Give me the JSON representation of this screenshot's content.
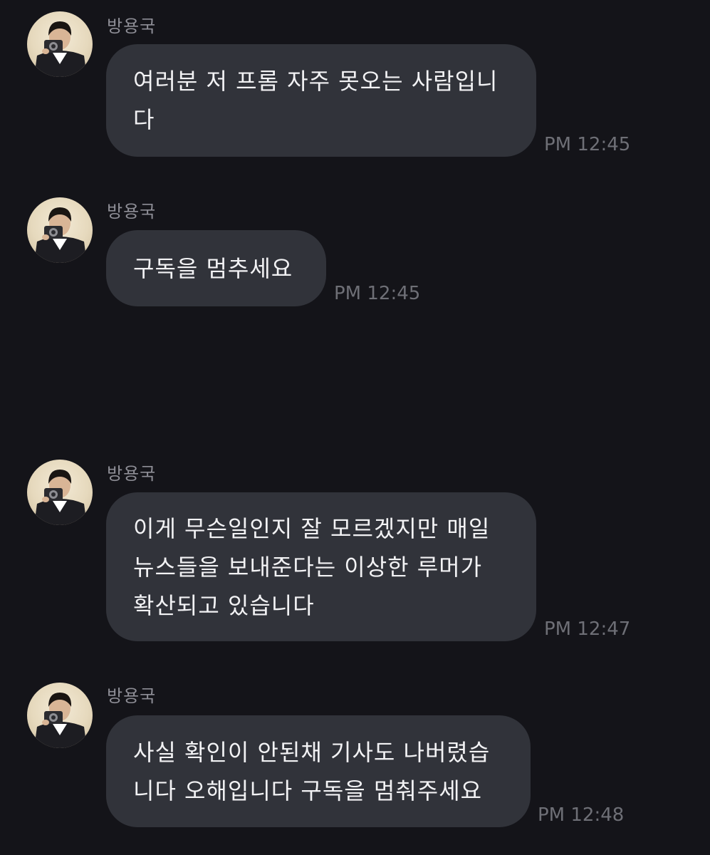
{
  "messages": [
    {
      "sender": "방용국",
      "lines": [
        "여러분 저 프롬 자주 못오는 사람입니",
        "다"
      ],
      "time": "PM 12:45"
    },
    {
      "sender": "방용국",
      "lines": [
        "구독을 멈추세요"
      ],
      "time": "PM 12:45"
    },
    {
      "sender": "방용국",
      "lines": [
        "이게 무슨일인지 잘 모르겠지만 매일",
        "뉴스들을 보내준다는 이상한 루머가",
        "확산되고 있습니다"
      ],
      "time": "PM 12:47"
    },
    {
      "sender": "방용국",
      "lines": [
        "사실 확인이 안된채 기사도 나버렸습",
        "니다 오해입니다 구독을 멈춰주세요"
      ],
      "time": "PM 12:48"
    }
  ],
  "colors": {
    "background": "#141419",
    "bubble": "#31333a",
    "message_text": "#f2f2f4",
    "sender_text": "#8e8e96",
    "time_text": "#6e6f76"
  }
}
